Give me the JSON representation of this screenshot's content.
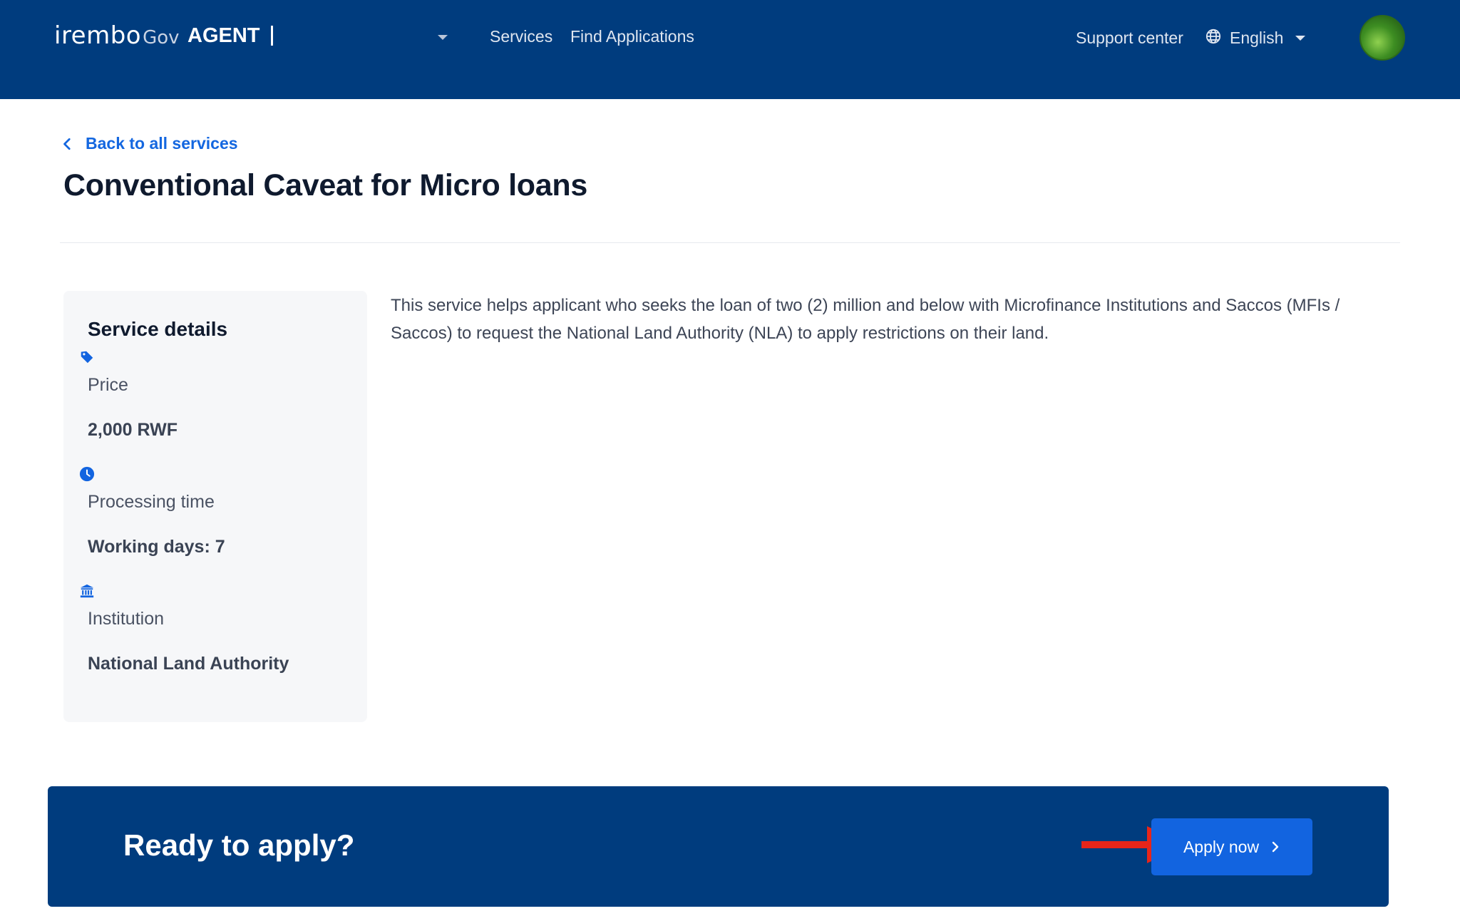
{
  "header": {
    "logo_main": "irembo",
    "logo_gov": "Gov",
    "role": "AGENT",
    "nav": [
      "Services",
      "Find Applications"
    ],
    "support": "Support center",
    "language": "English",
    "colors": {
      "topbar": "#003c7e",
      "accent": "#1264e0"
    }
  },
  "page": {
    "back_label": "Back to all services",
    "title": "Conventional Caveat for Micro loans",
    "description": "This service helps applicant who seeks the loan of two (2) million and below with Microfinance Institutions and Saccos (MFIs / Saccos) to request the National Land Authority (NLA) to apply restrictions on their land."
  },
  "details": {
    "title": "Service details",
    "items": [
      {
        "icon": "price-tag-icon",
        "label": "Price",
        "value": "2,000 RWF"
      },
      {
        "icon": "clock-icon",
        "label": "Processing time",
        "value": "Working days: 7"
      },
      {
        "icon": "institution-icon",
        "label": "Institution",
        "value": "National Land Authority"
      }
    ]
  },
  "cta": {
    "text": "Ready to apply?",
    "button": "Apply now"
  }
}
